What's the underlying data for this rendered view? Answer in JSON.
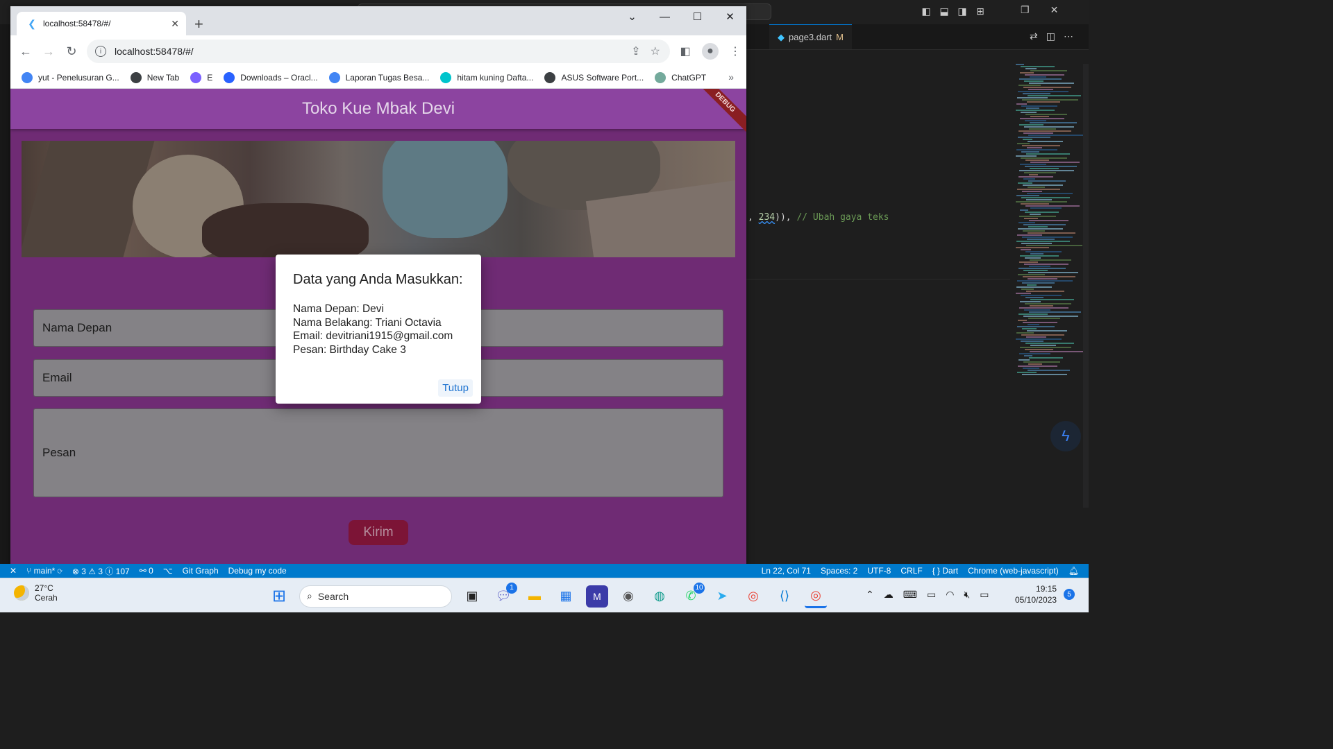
{
  "browser": {
    "tab_title": "localhost:58478/#/",
    "url": "localhost:58478/#/",
    "bookmarks": [
      {
        "label": "yut - Penelusuran G...",
        "icon": "google-icon",
        "color": "#4285f4"
      },
      {
        "label": "New Tab",
        "icon": "globe-icon",
        "color": "#3c4043"
      },
      {
        "label": "E",
        "icon": "bookmark-e-icon",
        "color": "#7b61ff"
      },
      {
        "label": "Downloads – Oracl...",
        "icon": "oracle-icon",
        "color": "#2962ff"
      },
      {
        "label": "Laporan Tugas Besa...",
        "icon": "docs-icon",
        "color": "#4285f4"
      },
      {
        "label": "hitam kuning Dafta...",
        "icon": "canva-icon",
        "color": "#00c4cc"
      },
      {
        "label": "ASUS Software Port...",
        "icon": "globe-icon",
        "color": "#3c4043"
      },
      {
        "label": "ChatGPT",
        "icon": "chatgpt-icon",
        "color": "#74aa9c"
      }
    ],
    "more_bookmarks": "»"
  },
  "app": {
    "title": "Toko Kue Mbak Devi",
    "debug_banner": "DEBUG",
    "fields": {
      "first_name": "Nama Depan",
      "email": "Email",
      "message": "Pesan"
    },
    "submit_label": "Kirim",
    "colors": {
      "primary": "#8c44a0",
      "button": "#7c1436"
    }
  },
  "dialog": {
    "title": "Data yang Anda Masukkan:",
    "lines": [
      "Nama Depan: Devi",
      "Nama Belakang: Triani Octavia",
      "Email: devitriani1915@gmail.com",
      "Pesan: Birthday Cake 3"
    ],
    "close_label": "Tutup"
  },
  "vscode": {
    "tab_label": "page3.dart",
    "tab_status": "M",
    "code": {
      "pre": ", ",
      "number": "234",
      "post": ")), ",
      "comment": "// Ubah gaya teks"
    },
    "status_left": [
      "main*",
      "⊗ 3 ⚠ 3 ⓘ 107",
      "⚯ 0",
      "Git Graph",
      "Debug my code"
    ],
    "status_right": [
      "Ln 22, Col 71",
      "Spaces: 2",
      "UTF-8",
      "CRLF",
      "{ } Dart",
      "Chrome (web-javascript)"
    ]
  },
  "taskbar": {
    "weather_temp": "27°C",
    "weather_desc": "Cerah",
    "search_placeholder": "Search",
    "teams_badge": "1",
    "whatsapp_badge": "10",
    "time": "19:15",
    "date": "05/10/2023",
    "notification_count": "5"
  }
}
